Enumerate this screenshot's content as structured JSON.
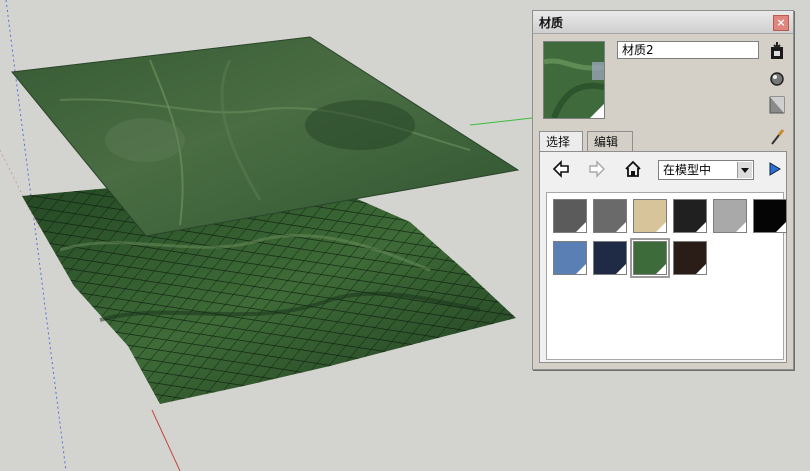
{
  "panel": {
    "title": "材质",
    "close_label": "×",
    "material_name": "材质2",
    "tabs": [
      {
        "label": "选择"
      },
      {
        "label": "编辑"
      }
    ],
    "collection": "在模型中",
    "icons": {
      "back": "back-arrow-icon",
      "forward": "forward-arrow-icon",
      "home": "home-icon",
      "details": "details-arrow-icon",
      "create": "create-material-icon",
      "sample": "sample-paint-icon",
      "default": "default-material-icon",
      "eyedropper": "eyedropper-icon"
    },
    "swatches": [
      {
        "color": "#5b5b5b",
        "selected": false
      },
      {
        "color": "#6a6a6a",
        "selected": false
      },
      {
        "color": "#d8c49a",
        "selected": false
      },
      {
        "color": "#202020",
        "selected": false
      },
      {
        "color": "#a9a9a9",
        "selected": false
      },
      {
        "color": "#050505",
        "selected": false
      },
      {
        "color": "#5a7fb4",
        "selected": false
      },
      {
        "color": "#1f2b45",
        "selected": false
      },
      {
        "color": "#3d6b3a",
        "selected": true
      },
      {
        "color": "#2a1c16",
        "selected": false
      }
    ]
  },
  "colors": {
    "scene_bg": "#d3d3cf",
    "terrain_dark": "#1d3a1e",
    "terrain_light": "#4d7a45",
    "axis_red": "#c24a40",
    "axis_green": "#3bbf3b",
    "axis_blue": "#5a6fd8"
  }
}
